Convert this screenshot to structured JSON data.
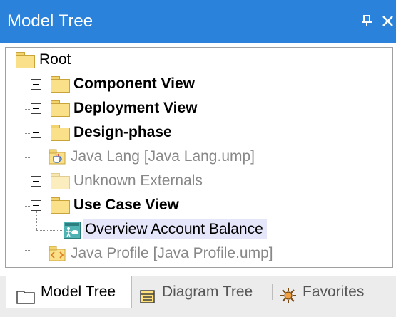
{
  "panel": {
    "title": "Model Tree",
    "pin_glyph": "▅",
    "close_glyph": "✕"
  },
  "tree": {
    "root": "Root",
    "items": [
      {
        "label": "Component View",
        "icon": "folder-icon",
        "style": "bold"
      },
      {
        "label": "Deployment View",
        "icon": "folder-icon",
        "style": "bold"
      },
      {
        "label": "Design-phase",
        "icon": "folder-icon",
        "style": "bold"
      },
      {
        "label": "Java Lang [Java Lang.ump]",
        "icon": "java-package-icon",
        "style": "gray"
      },
      {
        "label": "Unknown Externals",
        "icon": "folder-icon",
        "style": "gray"
      },
      {
        "label": "Use Case View",
        "icon": "folder-icon",
        "style": "bold",
        "expanded": true
      },
      {
        "label": "Overview Account Balance",
        "icon": "use-case-diagram-icon",
        "style": "selected"
      },
      {
        "label": "Java Profile [Java Profile.ump]",
        "icon": "profile-package-icon",
        "style": "gray"
      }
    ]
  },
  "tabs": [
    {
      "label": "Model Tree",
      "icon": "folder-icon",
      "active": true
    },
    {
      "label": "Diagram Tree",
      "icon": "diagram-tree-icon",
      "active": false
    },
    {
      "label": "Favorites",
      "icon": "favorites-icon",
      "active": false
    }
  ],
  "colors": {
    "titlebar": "#2a82da",
    "selection": "#e6e6fa",
    "folder": "#fbe08a"
  }
}
